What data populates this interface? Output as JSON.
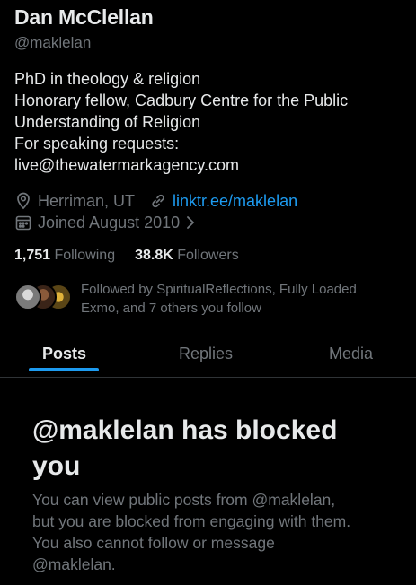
{
  "profile": {
    "name": "Dan McClellan",
    "handle": "@maklelan",
    "bio_lines": [
      "PhD in theology & religion",
      "Honorary fellow, Cadbury Centre for the Public",
      "Understanding of Religion",
      "For speaking requests:",
      "live@thewatermarkagency.com"
    ],
    "location": "Herriman, UT",
    "website": "linktr.ee/maklelan",
    "joined": "Joined August 2010",
    "following_count": "1,751",
    "following_label": "Following",
    "followers_count": "38.8K",
    "followers_label": "Followers",
    "followed_by_lines": [
      "Followed by SpiritualReflections, Fully Loaded",
      "Exmo, and 7 others you follow"
    ]
  },
  "tabs": [
    {
      "label": "Posts",
      "active": true
    },
    {
      "label": "Replies",
      "active": false
    },
    {
      "label": "Media",
      "active": false
    }
  ],
  "blocked": {
    "title_lines": [
      "@maklelan has blocked",
      "you"
    ],
    "message_lines": [
      "You can view public posts from @maklelan,",
      "but you are blocked from engaging with them.",
      "You also cannot follow or message",
      "@maklelan."
    ]
  },
  "colors": {
    "background": "#000000",
    "primary_text": "#e7e9ea",
    "secondary_text": "#71767b",
    "accent": "#1d9bf0"
  },
  "icons": [
    "location-pin-icon",
    "link-icon",
    "calendar-icon",
    "chevron-right-icon"
  ]
}
